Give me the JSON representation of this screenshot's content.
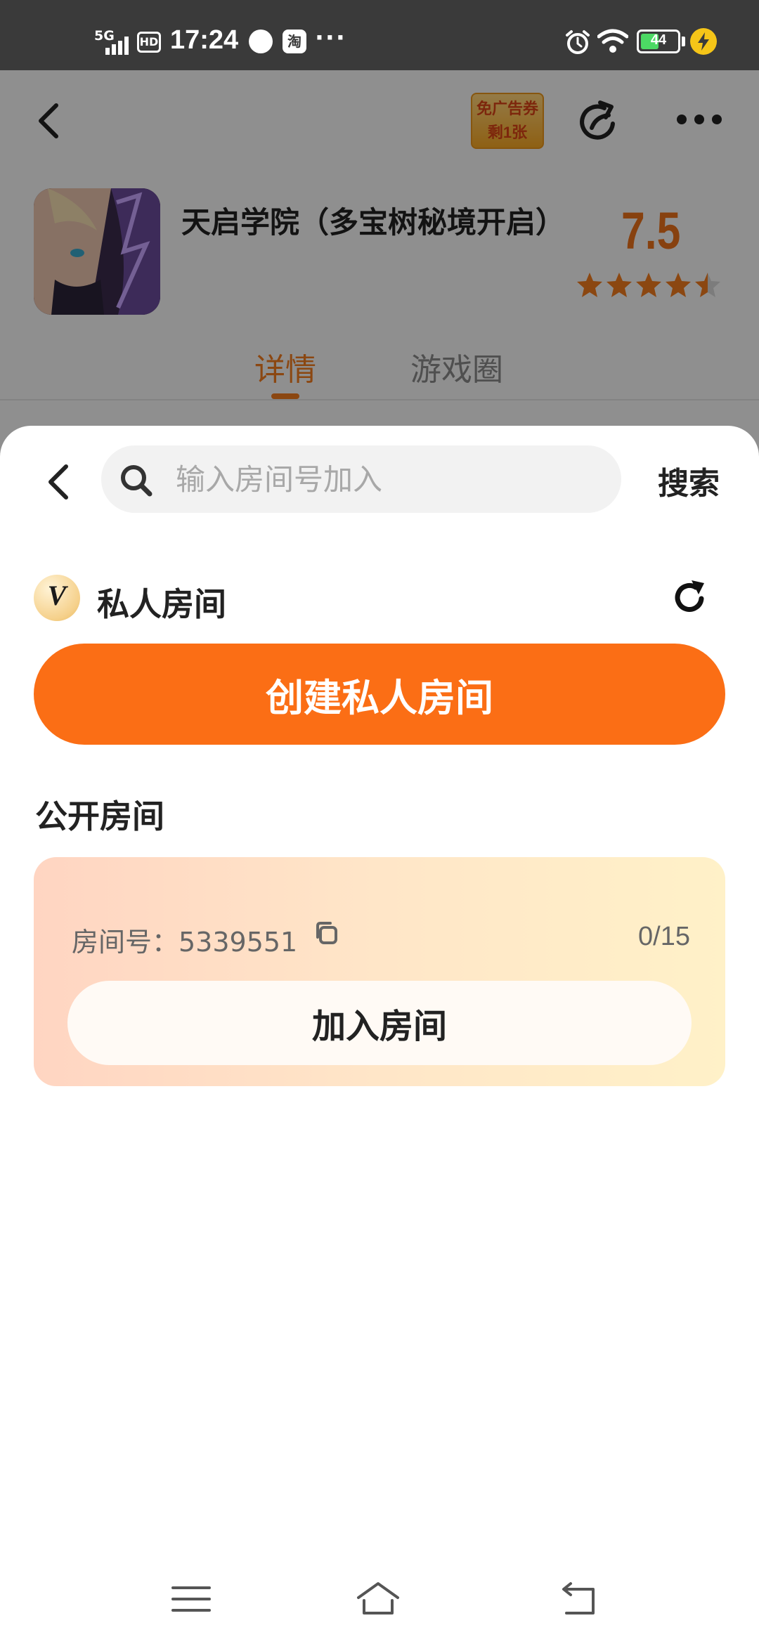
{
  "status_bar": {
    "network": "5G",
    "hd": "HD",
    "time": "17:24",
    "app_icon_label": "淘",
    "more": "···",
    "battery_level": 44,
    "battery_text": "44"
  },
  "header": {
    "voucher_line1": "免广告券",
    "voucher_line2": "剩1张"
  },
  "game": {
    "title": "天启学院（多宝树秘境开启）",
    "rating": "7.5",
    "stars": 4.5,
    "accent_color": "#f07a1e"
  },
  "tabs": [
    {
      "label": "详情",
      "active": true
    },
    {
      "label": "游戏圈",
      "active": false
    }
  ],
  "sheet": {
    "search": {
      "placeholder": "输入房间号加入",
      "value": "",
      "button_label": "搜索"
    },
    "private_room": {
      "badge": "V",
      "label": "私人房间",
      "create_label": "创建私人房间",
      "create_color": "#fb6e15"
    },
    "public_room": {
      "label": "公开房间",
      "rooms": [
        {
          "id_label": "房间号：5339551",
          "count": "0/15",
          "join_label": "加入房间"
        }
      ]
    }
  },
  "icons": {
    "back": "chevron-left-icon",
    "share": "share-icon",
    "more": "more-dots-icon",
    "search": "search-icon",
    "refresh": "refresh-icon",
    "copy": "copy-icon"
  }
}
